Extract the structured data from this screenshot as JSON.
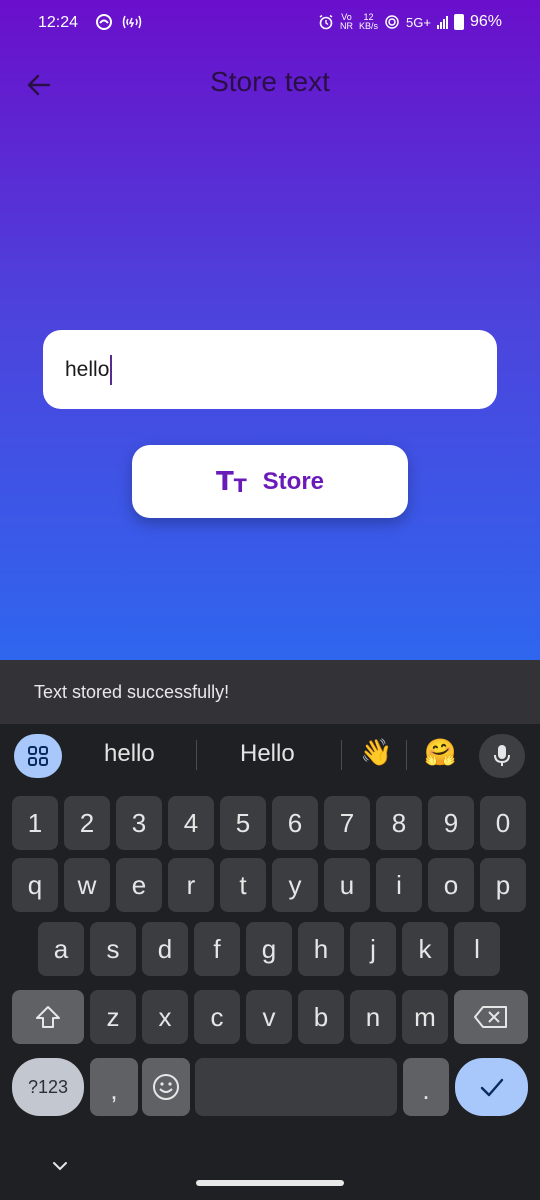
{
  "status_bar": {
    "time": "12:24",
    "network_speed_value": "12",
    "network_speed_unit": "KB/s",
    "volte": "Vo",
    "nr": "NR",
    "network_type": "5G+",
    "battery": "96%"
  },
  "header": {
    "title": "Store text",
    "back_icon": "arrow-left-icon"
  },
  "form": {
    "input_value": "hello",
    "store_button_label": "Store",
    "store_button_icon": "text-format-icon"
  },
  "snackbar": {
    "message": "Text stored successfully!"
  },
  "keyboard": {
    "suggestions": [
      "hello",
      "Hello"
    ],
    "emoji_suggestions": [
      "👋",
      "🤗"
    ],
    "row_numbers": [
      "1",
      "2",
      "3",
      "4",
      "5",
      "6",
      "7",
      "8",
      "9",
      "0"
    ],
    "row_1": [
      "q",
      "w",
      "e",
      "r",
      "t",
      "y",
      "u",
      "i",
      "o",
      "p"
    ],
    "row_2": [
      "a",
      "s",
      "d",
      "f",
      "g",
      "h",
      "j",
      "k",
      "l"
    ],
    "row_3": [
      "z",
      "x",
      "c",
      "v",
      "b",
      "n",
      "m"
    ],
    "symbols_key": "?123",
    "comma_key": ",",
    "period_key": "."
  },
  "colors": {
    "gradient_top": "#6a0fcb",
    "gradient_bottom": "#2f66ef",
    "accent_purple": "#6a1ab8",
    "keyboard_accent": "#a8c7fa"
  }
}
